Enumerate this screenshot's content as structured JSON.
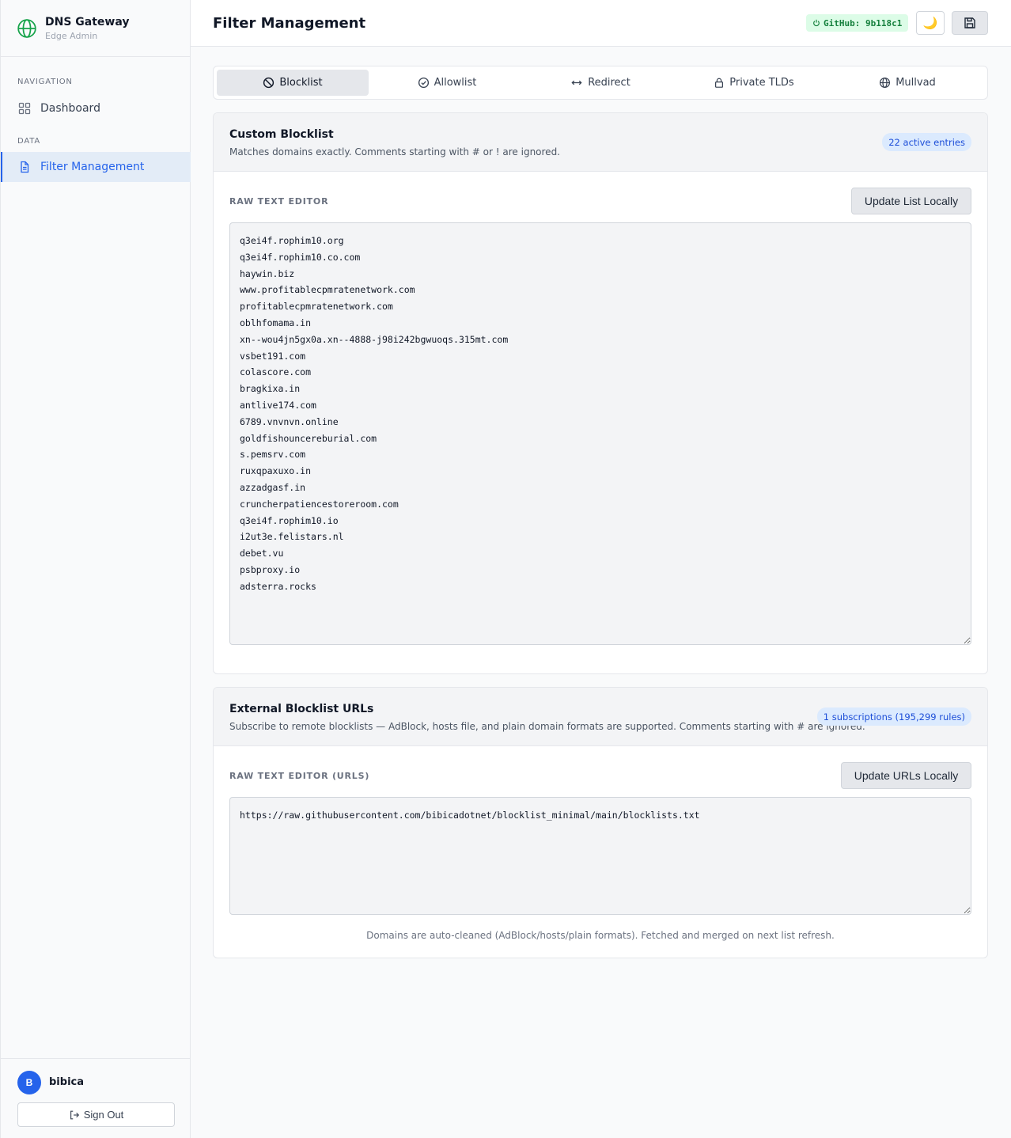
{
  "brand": {
    "title": "DNS Gateway",
    "subtitle": "Edge Admin",
    "icon": "globe-icon"
  },
  "sidebar": {
    "sections": [
      {
        "label": "NAVIGATION",
        "items": [
          {
            "label": "Dashboard",
            "icon": "grid-icon"
          }
        ]
      },
      {
        "label": "DATA",
        "items": [
          {
            "label": "Filter Management",
            "icon": "file-icon",
            "active": true
          }
        ]
      }
    ]
  },
  "user": {
    "initial": "B",
    "name": "bibica",
    "signout_label": "Sign Out"
  },
  "header": {
    "title": "Filter Management",
    "github_badge": "GitHub: 9b118c1",
    "theme_icon": "🌙"
  },
  "tabs": [
    {
      "label": "Blocklist",
      "icon": "ban-icon",
      "active": true
    },
    {
      "label": "Allowlist",
      "icon": "check-circle-icon"
    },
    {
      "label": "Redirect",
      "icon": "arrows-horizontal-icon"
    },
    {
      "label": "Private TLDs",
      "icon": "lock-icon"
    },
    {
      "label": "Mullvad",
      "icon": "globe-icon"
    }
  ],
  "custom_blocklist": {
    "title": "Custom Blocklist",
    "description": "Matches domains exactly. Comments starting with # or ! are ignored.",
    "badge": "22 active entries",
    "editor_label": "RAW TEXT EDITOR",
    "update_label": "Update List Locally",
    "content": "q3ei4f.rophim10.org\nq3ei4f.rophim10.co.com\nhaywin.biz\nwww.profitablecpmratenetwork.com\nprofitablecpmratenetwork.com\noblhfomama.in\nxn--wou4jn5gx0a.xn--4888-j98i242bgwuoqs.315mt.com\nvsbet191.com\ncolascore.com\nbragkixa.in\nantlive174.com\n6789.vnvnvn.online\ngoldfishouncereburial.com\ns.pemsrv.com\nruxqpaxuxo.in\nazzadgasf.in\ncruncherpatiencestoreroom.com\nq3ei4f.rophim10.io\ni2ut3e.felistars.nl\ndebet.vu\npsbproxy.io\nadsterra.rocks"
  },
  "external_blocklist": {
    "title": "External Blocklist URLs",
    "description": "Subscribe to remote blocklists — AdBlock, hosts file, and plain domain formats are supported. Comments starting with # are ignored.",
    "badge": "1 subscriptions (195,299 rules)",
    "editor_label": "RAW TEXT EDITOR (URLS)",
    "update_label": "Update URLs Locally",
    "content": "https://raw.githubusercontent.com/bibicadotnet/blocklist_minimal/main/blocklists.txt",
    "footnote": "Domains are auto-cleaned (AdBlock/hosts/plain formats). Fetched and merged on next list refresh."
  },
  "colors": {
    "accent": "#2563eb",
    "badge_green_bg": "#dcfce7",
    "badge_green_text": "#15803d",
    "badge_blue_bg": "#dbeafe"
  }
}
